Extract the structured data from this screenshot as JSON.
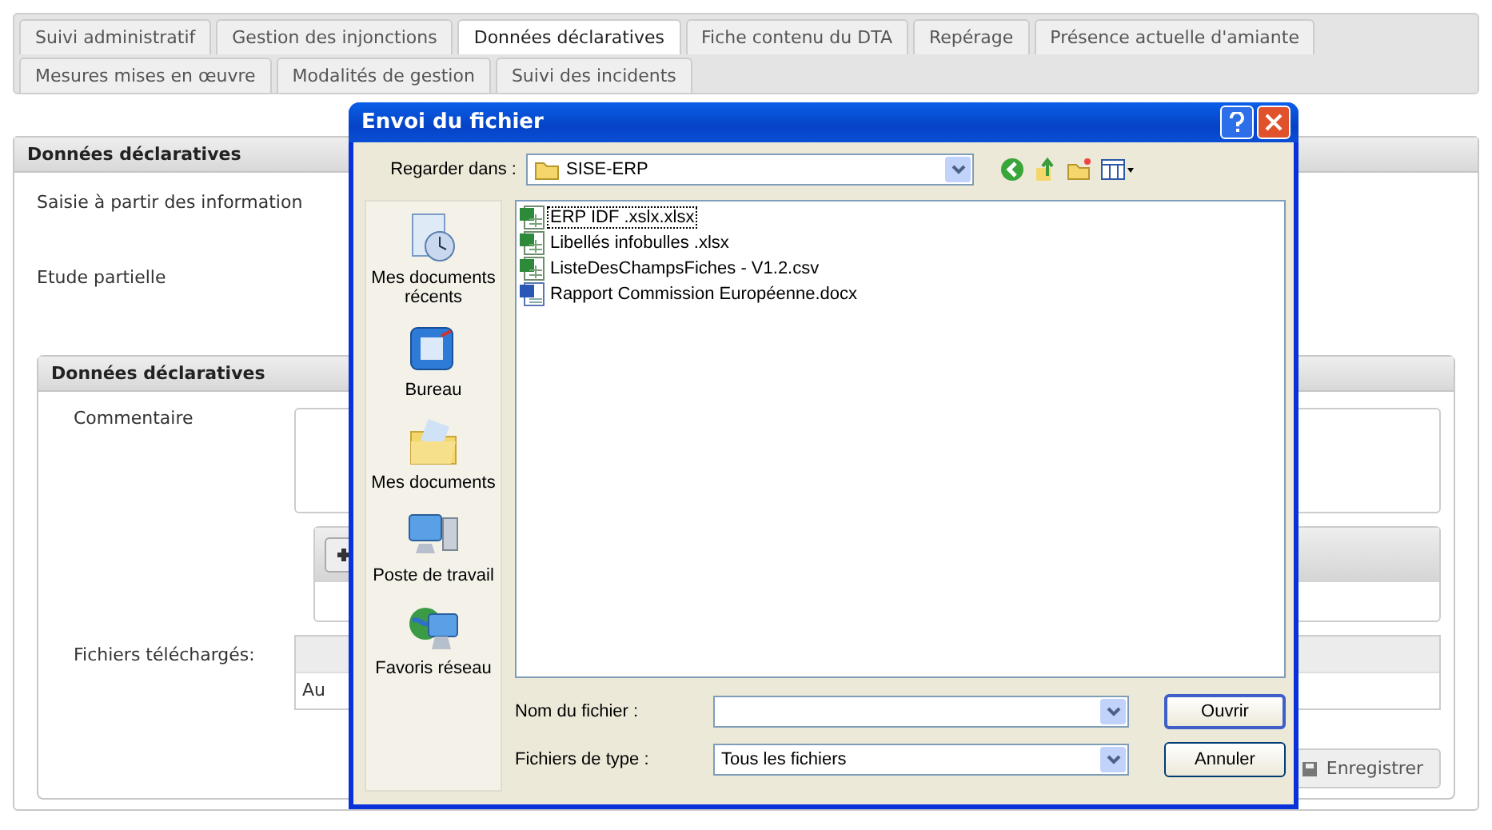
{
  "tabs": [
    [
      {
        "label": "Suivi administratif",
        "selected": false
      },
      {
        "label": "Gestion des injonctions",
        "selected": false
      },
      {
        "label": "Données déclaratives",
        "selected": true
      },
      {
        "label": "Fiche contenu du DTA",
        "selected": false
      },
      {
        "label": "Repérage",
        "selected": false
      },
      {
        "label": "Présence actuelle d'amiante",
        "selected": false
      }
    ],
    [
      {
        "label": "Mesures mises en œuvre",
        "selected": false
      },
      {
        "label": "Modalités de gestion",
        "selected": false
      },
      {
        "label": "Suivi des incidents",
        "selected": false
      }
    ]
  ],
  "panel": {
    "title": "Données déclaratives",
    "intro": "Saisie à partir des information",
    "field": "Etude partielle"
  },
  "inner_panel": {
    "title": "Données déclaratives",
    "comment_label": "Commentaire",
    "files_label": "Fichiers téléchargés:",
    "files_row": "Au"
  },
  "save_button": "Enregistrer",
  "dialog": {
    "title": "Envoi du fichier",
    "look_in_label": "Regarder dans :",
    "look_in_value": "SISE-ERP",
    "places": [
      {
        "kind": "recent",
        "label": "Mes documents récents"
      },
      {
        "kind": "desktop",
        "label": "Bureau"
      },
      {
        "kind": "documents",
        "label": "Mes documents"
      },
      {
        "kind": "computer",
        "label": "Poste de travail"
      },
      {
        "kind": "network",
        "label": "Favoris réseau"
      }
    ],
    "files": [
      {
        "kind": "excel",
        "name": "ERP IDF .xslx.xlsx",
        "selected": true
      },
      {
        "kind": "excel",
        "name": "Libellés infobulles .xlsx",
        "selected": false
      },
      {
        "kind": "excel",
        "name": "ListeDesChampsFiches - V1.2.csv",
        "selected": false
      },
      {
        "kind": "word",
        "name": "Rapport Commission Européenne.docx",
        "selected": false
      }
    ],
    "filename_label": "Nom du fichier :",
    "filetype_label": "Fichiers de type :",
    "filetype_value": "Tous les fichiers",
    "open_button": "Ouvrir",
    "cancel_button": "Annuler"
  }
}
